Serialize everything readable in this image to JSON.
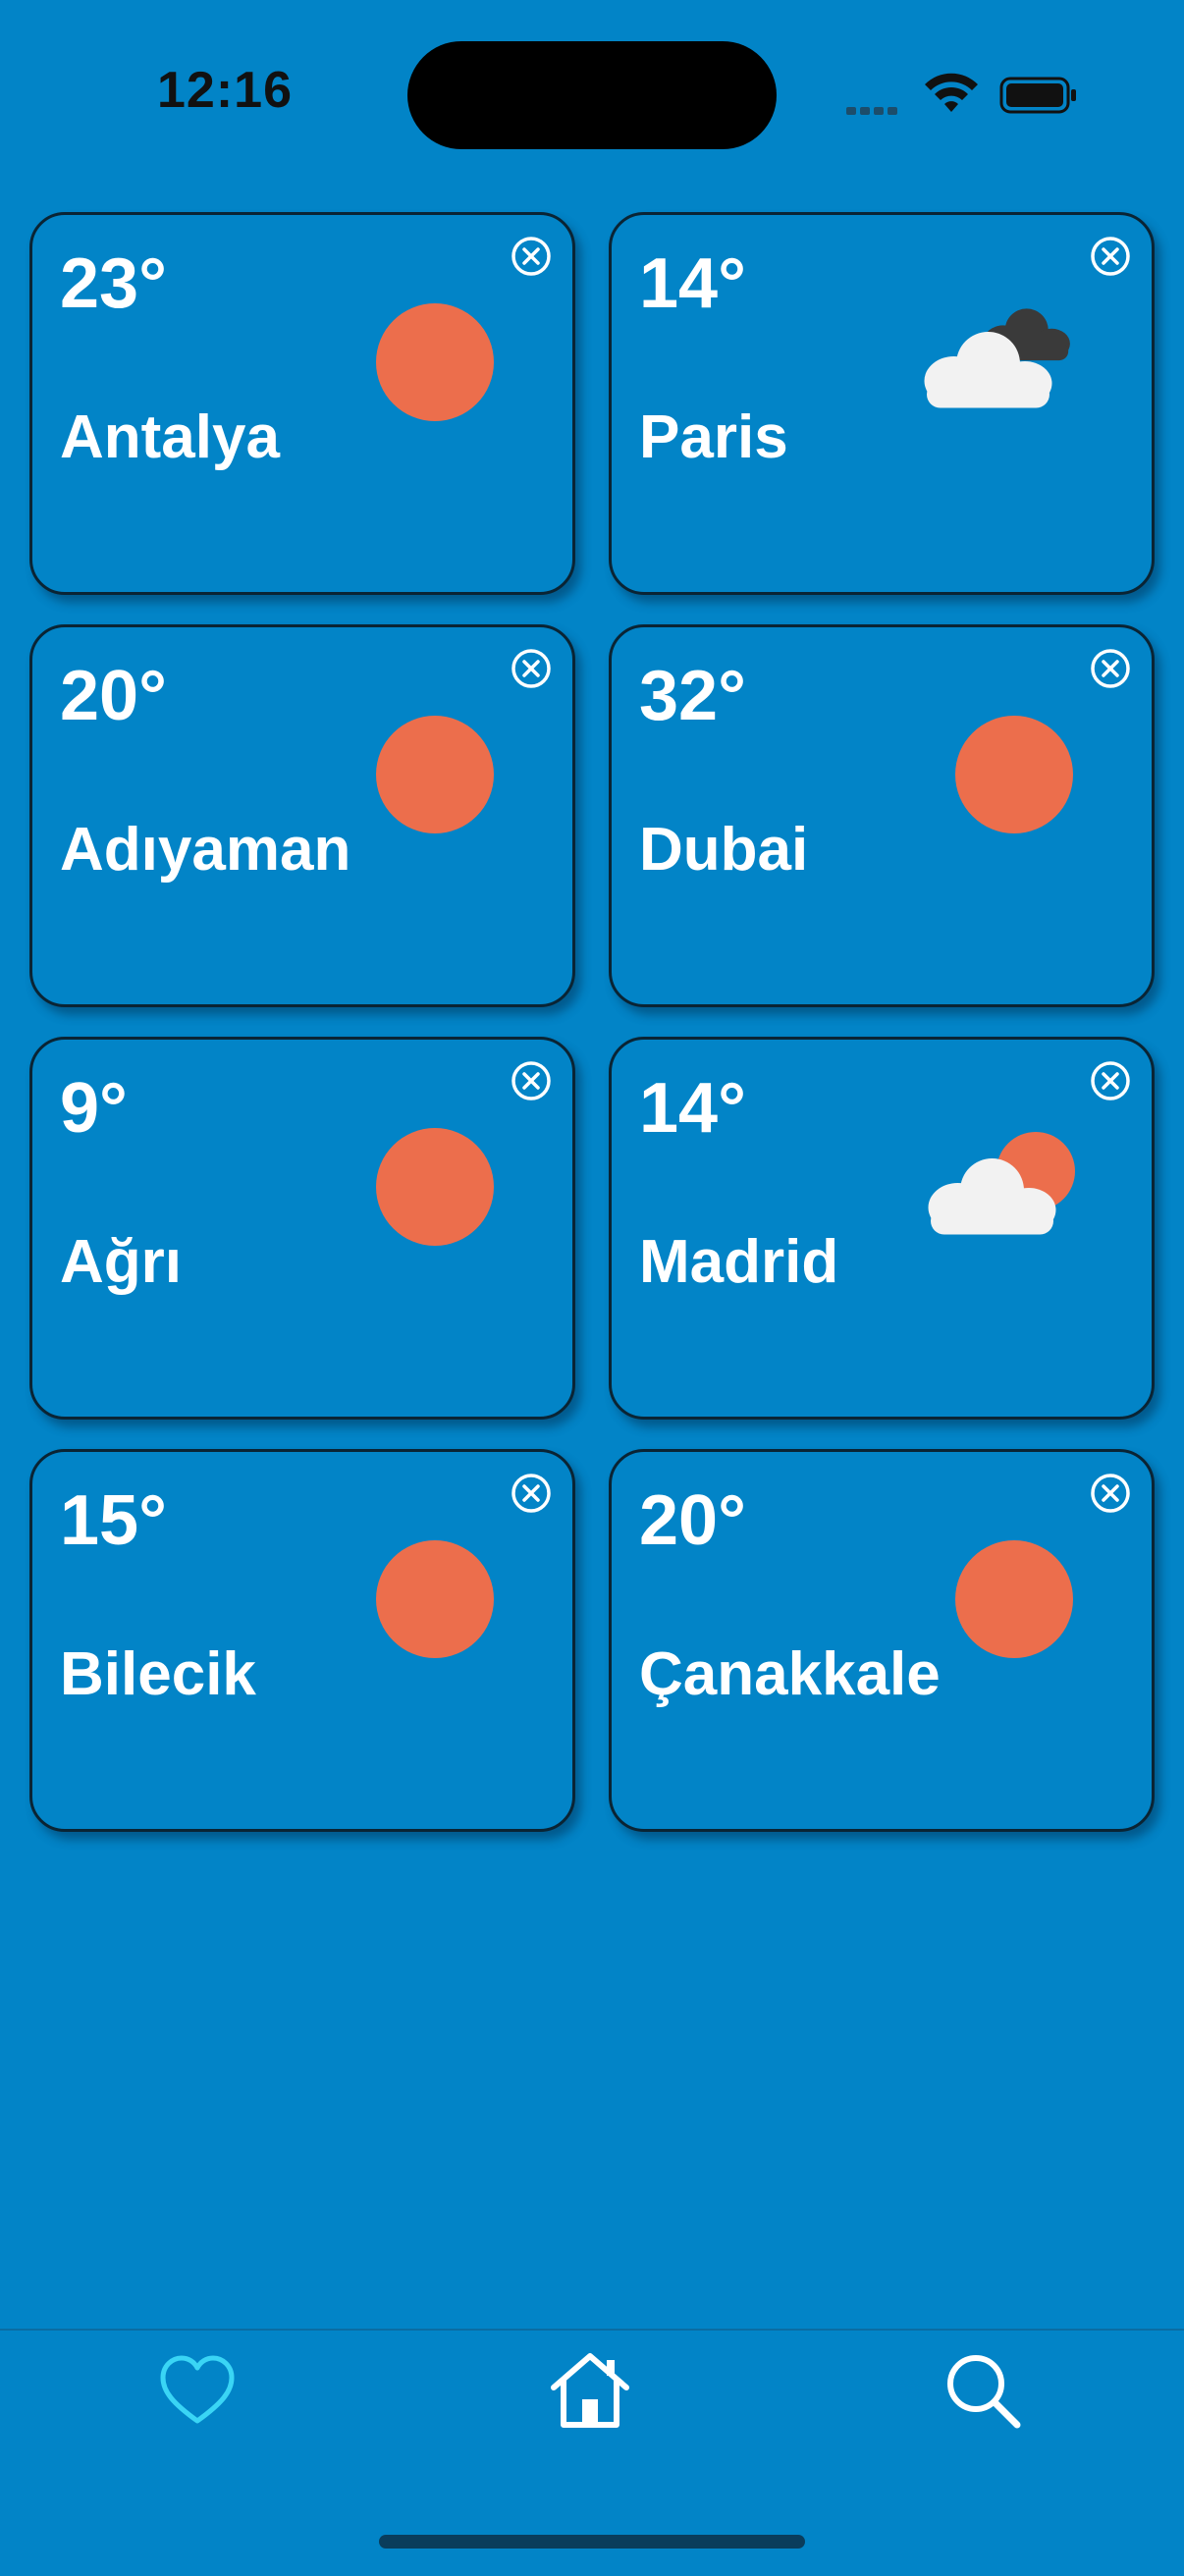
{
  "status_bar": {
    "time": "12:16",
    "icons": [
      "cellular-signal-icon",
      "wifi-icon",
      "battery-icon"
    ]
  },
  "cities": [
    {
      "temp": "23°",
      "name": "Antalya",
      "icon": "sun"
    },
    {
      "temp": "14°",
      "name": "Paris",
      "icon": "cloudy"
    },
    {
      "temp": "20°",
      "name": "Adıyaman",
      "icon": "sun"
    },
    {
      "temp": "32°",
      "name": "Dubai",
      "icon": "sun"
    },
    {
      "temp": "9°",
      "name": "Ağrı",
      "icon": "sun"
    },
    {
      "temp": "14°",
      "name": "Madrid",
      "icon": "partly-cloudy"
    },
    {
      "temp": "15°",
      "name": "Bilecik",
      "icon": "sun"
    },
    {
      "temp": "20°",
      "name": "Çanakkale",
      "icon": "sun"
    }
  ],
  "tab_bar": {
    "tabs": [
      {
        "icon": "heart-icon",
        "active": true
      },
      {
        "icon": "home-icon",
        "active": false
      },
      {
        "icon": "search-icon",
        "active": false
      }
    ]
  },
  "colors": {
    "background": "#0284c7",
    "card_border": "#0a2434",
    "sun": "#ec6e4c",
    "cloud": "#f2f2f2",
    "dark_cloud": "#3a3a3a",
    "tab_active": "#3ad5f5",
    "tab_inactive": "#ffffff"
  }
}
